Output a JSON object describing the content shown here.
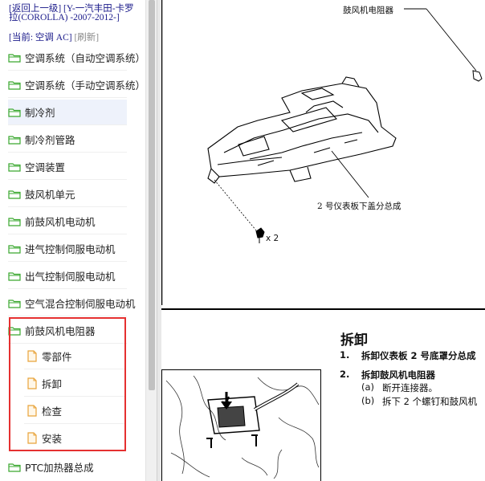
{
  "header": {
    "back_link": "[返回上一级]",
    "vehicle_link": "[Y-一汽丰田-卡罗拉(COROLLA) -2007-2012-]",
    "current_label": "[当前: 空调 AC]",
    "refresh_link": "[刷新]"
  },
  "nav": {
    "items": [
      {
        "label": "空调系统（自动空调系统）"
      },
      {
        "label": "空调系统（手动空调系统）"
      },
      {
        "label": "制冷剂"
      },
      {
        "label": "制冷剂管路"
      },
      {
        "label": "空调装置"
      },
      {
        "label": "鼓风机单元"
      },
      {
        "label": "前鼓风机电动机"
      },
      {
        "label": "进气控制伺服电动机"
      },
      {
        "label": "出气控制伺服电动机"
      },
      {
        "label": "空气混合控制伺服电动机"
      },
      {
        "label": "前鼓风机电阻器"
      }
    ],
    "sub_items": [
      {
        "label": "零部件"
      },
      {
        "label": "拆卸"
      },
      {
        "label": "检查"
      },
      {
        "label": "安装"
      }
    ],
    "last_item": {
      "label": "PTC加热器总成"
    }
  },
  "content": {
    "diagram1": {
      "label_resistor": "鼓风机电阻器",
      "label_panel": "2 号仪表板下盖分总成",
      "label_clip_count": "x 2"
    },
    "section_title": "拆卸",
    "steps": [
      {
        "num": "1.",
        "text": "拆卸仪表板 2 号底罩分总成"
      },
      {
        "num": "2.",
        "text": "拆卸鼓风机电阻器"
      }
    ],
    "substeps": [
      {
        "mark": "(a)",
        "text": "断开连接器。"
      },
      {
        "mark": "(b)",
        "text": "拆下 2 个螺钉和鼓风机"
      }
    ]
  },
  "colors": {
    "folder": "#3aa82f",
    "doc_icon": "#e8a33a",
    "highlight_box": "#e53030",
    "link": "#1a1a8a"
  }
}
